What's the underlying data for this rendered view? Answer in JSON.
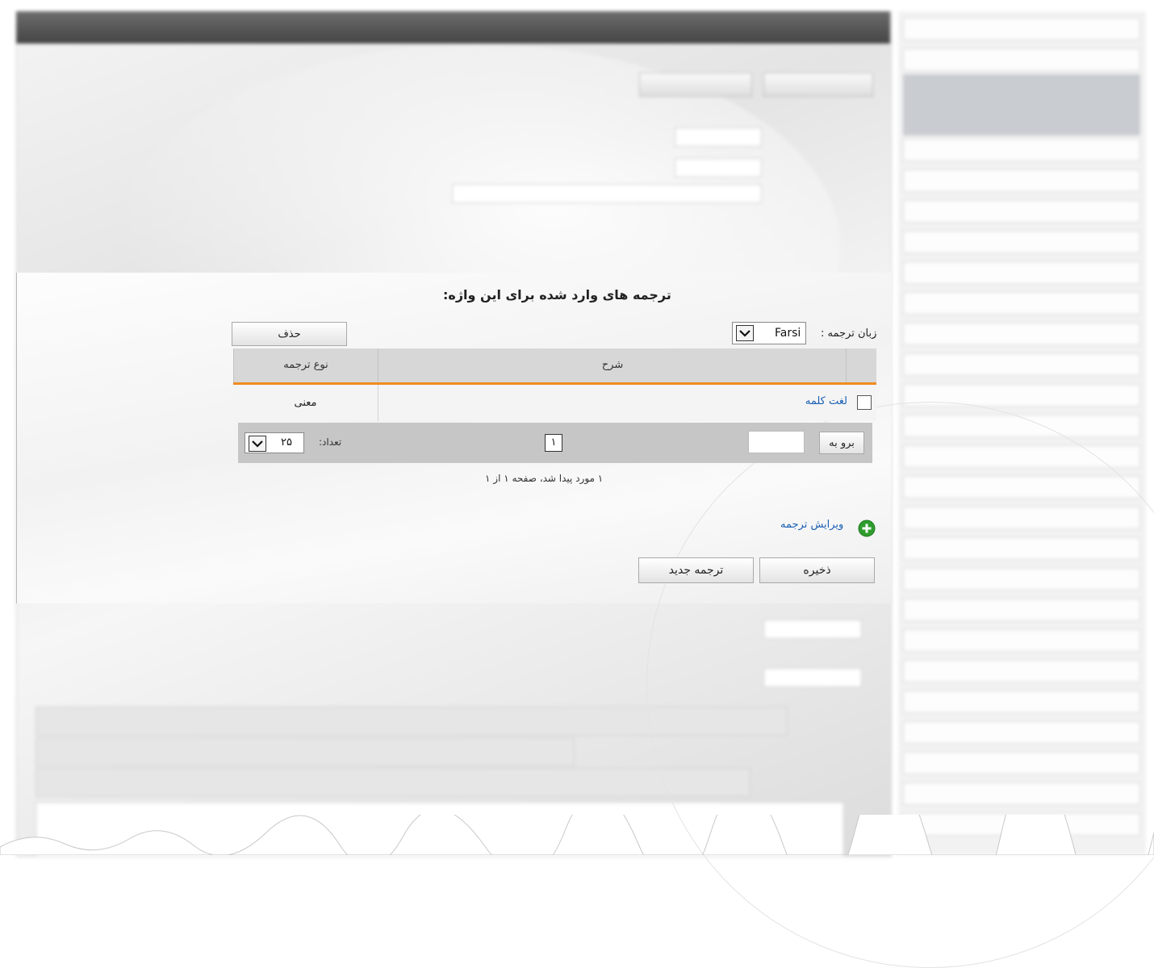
{
  "panel": {
    "title": "ترجمه های وارد شده برای این واژه:",
    "language_label": "زبان ترجمه :",
    "language_value": "Farsi",
    "delete_label": "حذف",
    "columns": {
      "description": "شرح",
      "type": "نوع ترجمه"
    },
    "rows": [
      {
        "link": "لغت کلمه",
        "type": "معنی",
        "checked": false
      }
    ],
    "pager": {
      "goto_label": "برو به",
      "goto_value": "",
      "current_page": "۱",
      "count_label": "تعداد:",
      "count_value": "۲۵"
    },
    "status": "۱ مورد پیدا شد، صفحه ۱ از ۱",
    "edit_translation_label": "ویرایش ترجمه",
    "save_label": "ذخیره",
    "new_translation_label": "ترجمه جدید"
  },
  "colors": {
    "accent_orange": "#f08c1e",
    "link_blue": "#1a5fb4",
    "plus_green": "#2e9d2e"
  },
  "icons": [
    "dropdown-arrow-icon",
    "plus-circle-icon",
    "checkbox"
  ]
}
